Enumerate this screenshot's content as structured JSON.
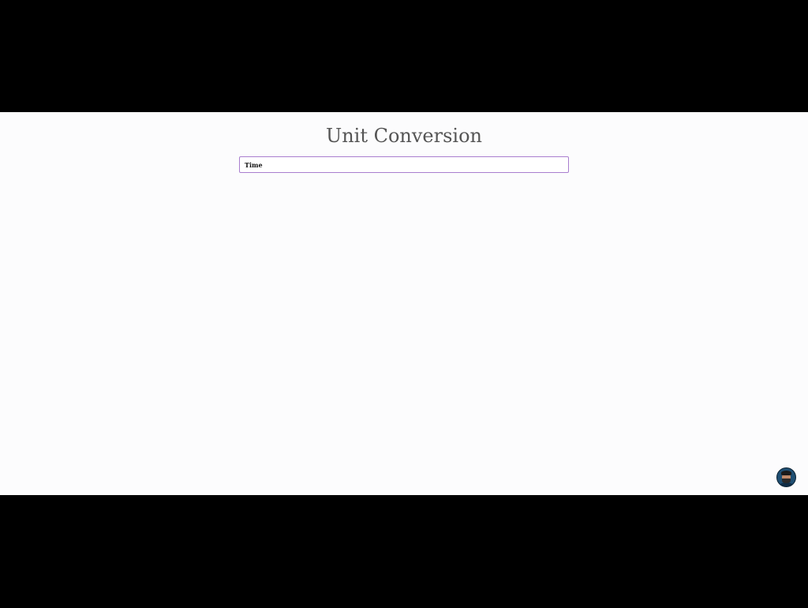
{
  "page": {
    "title": "Unit Conversion"
  },
  "converter": {
    "selected_category": "Time"
  },
  "colors": {
    "select_border": "#a97ecf",
    "title_text": "#555555",
    "background": "#fcfcfd",
    "letterbox": "#000000"
  },
  "icons": {
    "profile": "user-avatar-icon"
  }
}
